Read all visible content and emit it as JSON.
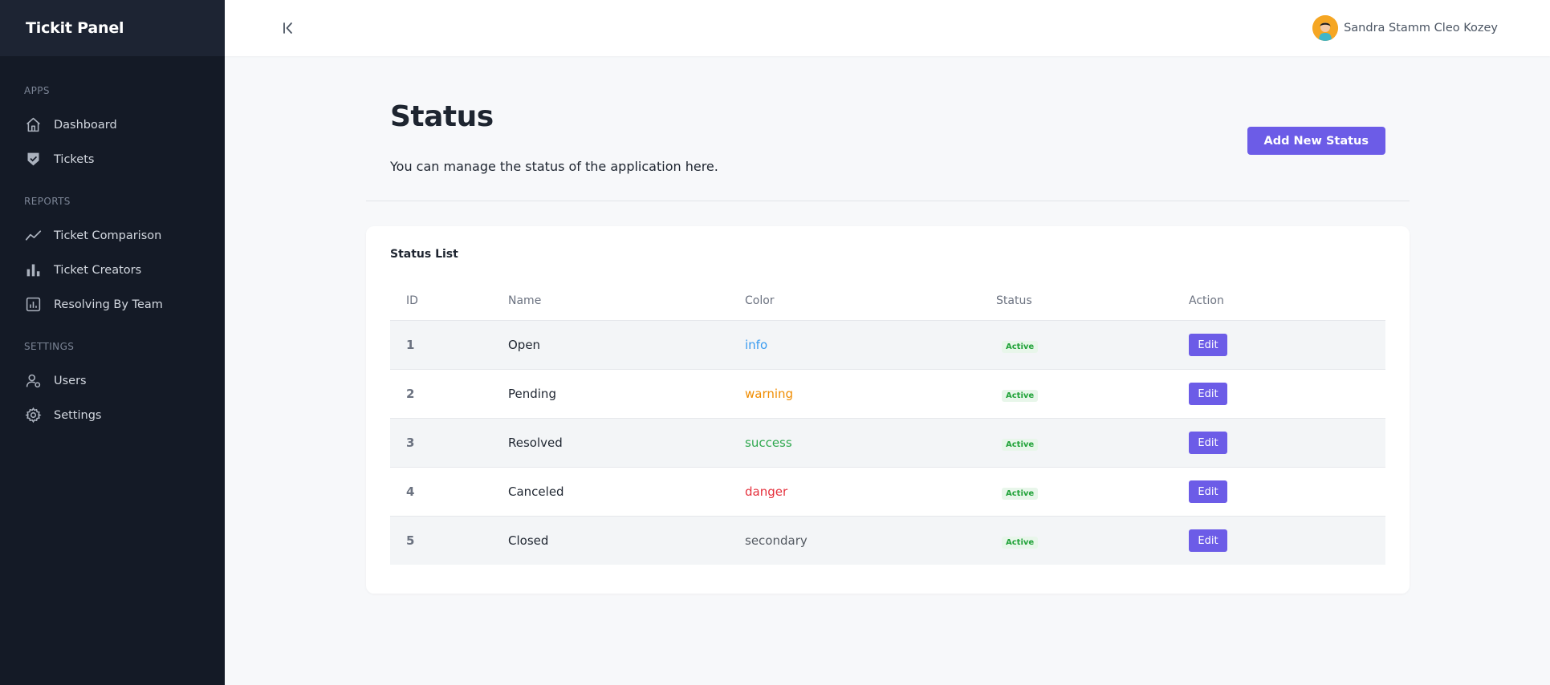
{
  "app": {
    "brand": "Tickit Panel"
  },
  "sidebar": {
    "sections": [
      {
        "label": "APPS",
        "items": [
          {
            "label": "Dashboard",
            "icon": "home-icon"
          },
          {
            "label": "Tickets",
            "icon": "shield-check-icon"
          }
        ]
      },
      {
        "label": "REPORTS",
        "items": [
          {
            "label": "Ticket Comparison",
            "icon": "trend-line-icon"
          },
          {
            "label": "Ticket Creators",
            "icon": "bar-chart-icon"
          },
          {
            "label": "Resolving By Team",
            "icon": "report-icon"
          }
        ]
      },
      {
        "label": "SETTINGS",
        "items": [
          {
            "label": "Users",
            "icon": "users-icon"
          },
          {
            "label": "Settings",
            "icon": "gear-icon"
          }
        ]
      }
    ]
  },
  "topbar": {
    "user_name": "Sandra Stamm Cleo Kozey"
  },
  "page": {
    "title": "Status",
    "subtitle": "You can manage the status of the application here.",
    "add_button": "Add New Status"
  },
  "card": {
    "title": "Status List",
    "columns": [
      "ID",
      "Name",
      "Color",
      "Status",
      "Action"
    ],
    "rows": [
      {
        "id": "1",
        "name": "Open",
        "color": "info",
        "color_hex": "#3b9cf0",
        "status": "Active",
        "action": "Edit"
      },
      {
        "id": "2",
        "name": "Pending",
        "color": "warning",
        "color_hex": "#f08c00",
        "status": "Active",
        "action": "Edit"
      },
      {
        "id": "3",
        "name": "Resolved",
        "color": "success",
        "color_hex": "#2fa84f",
        "status": "Active",
        "action": "Edit"
      },
      {
        "id": "4",
        "name": "Canceled",
        "color": "danger",
        "color_hex": "#e5323e",
        "status": "Active",
        "action": "Edit"
      },
      {
        "id": "5",
        "name": "Closed",
        "color": "secondary",
        "color_hex": "#555b63",
        "status": "Active",
        "action": "Edit"
      }
    ]
  },
  "colors": {
    "accent": "#6c5ce7",
    "sidebar_bg": "#141a26",
    "brand_bg": "#1d2433"
  }
}
